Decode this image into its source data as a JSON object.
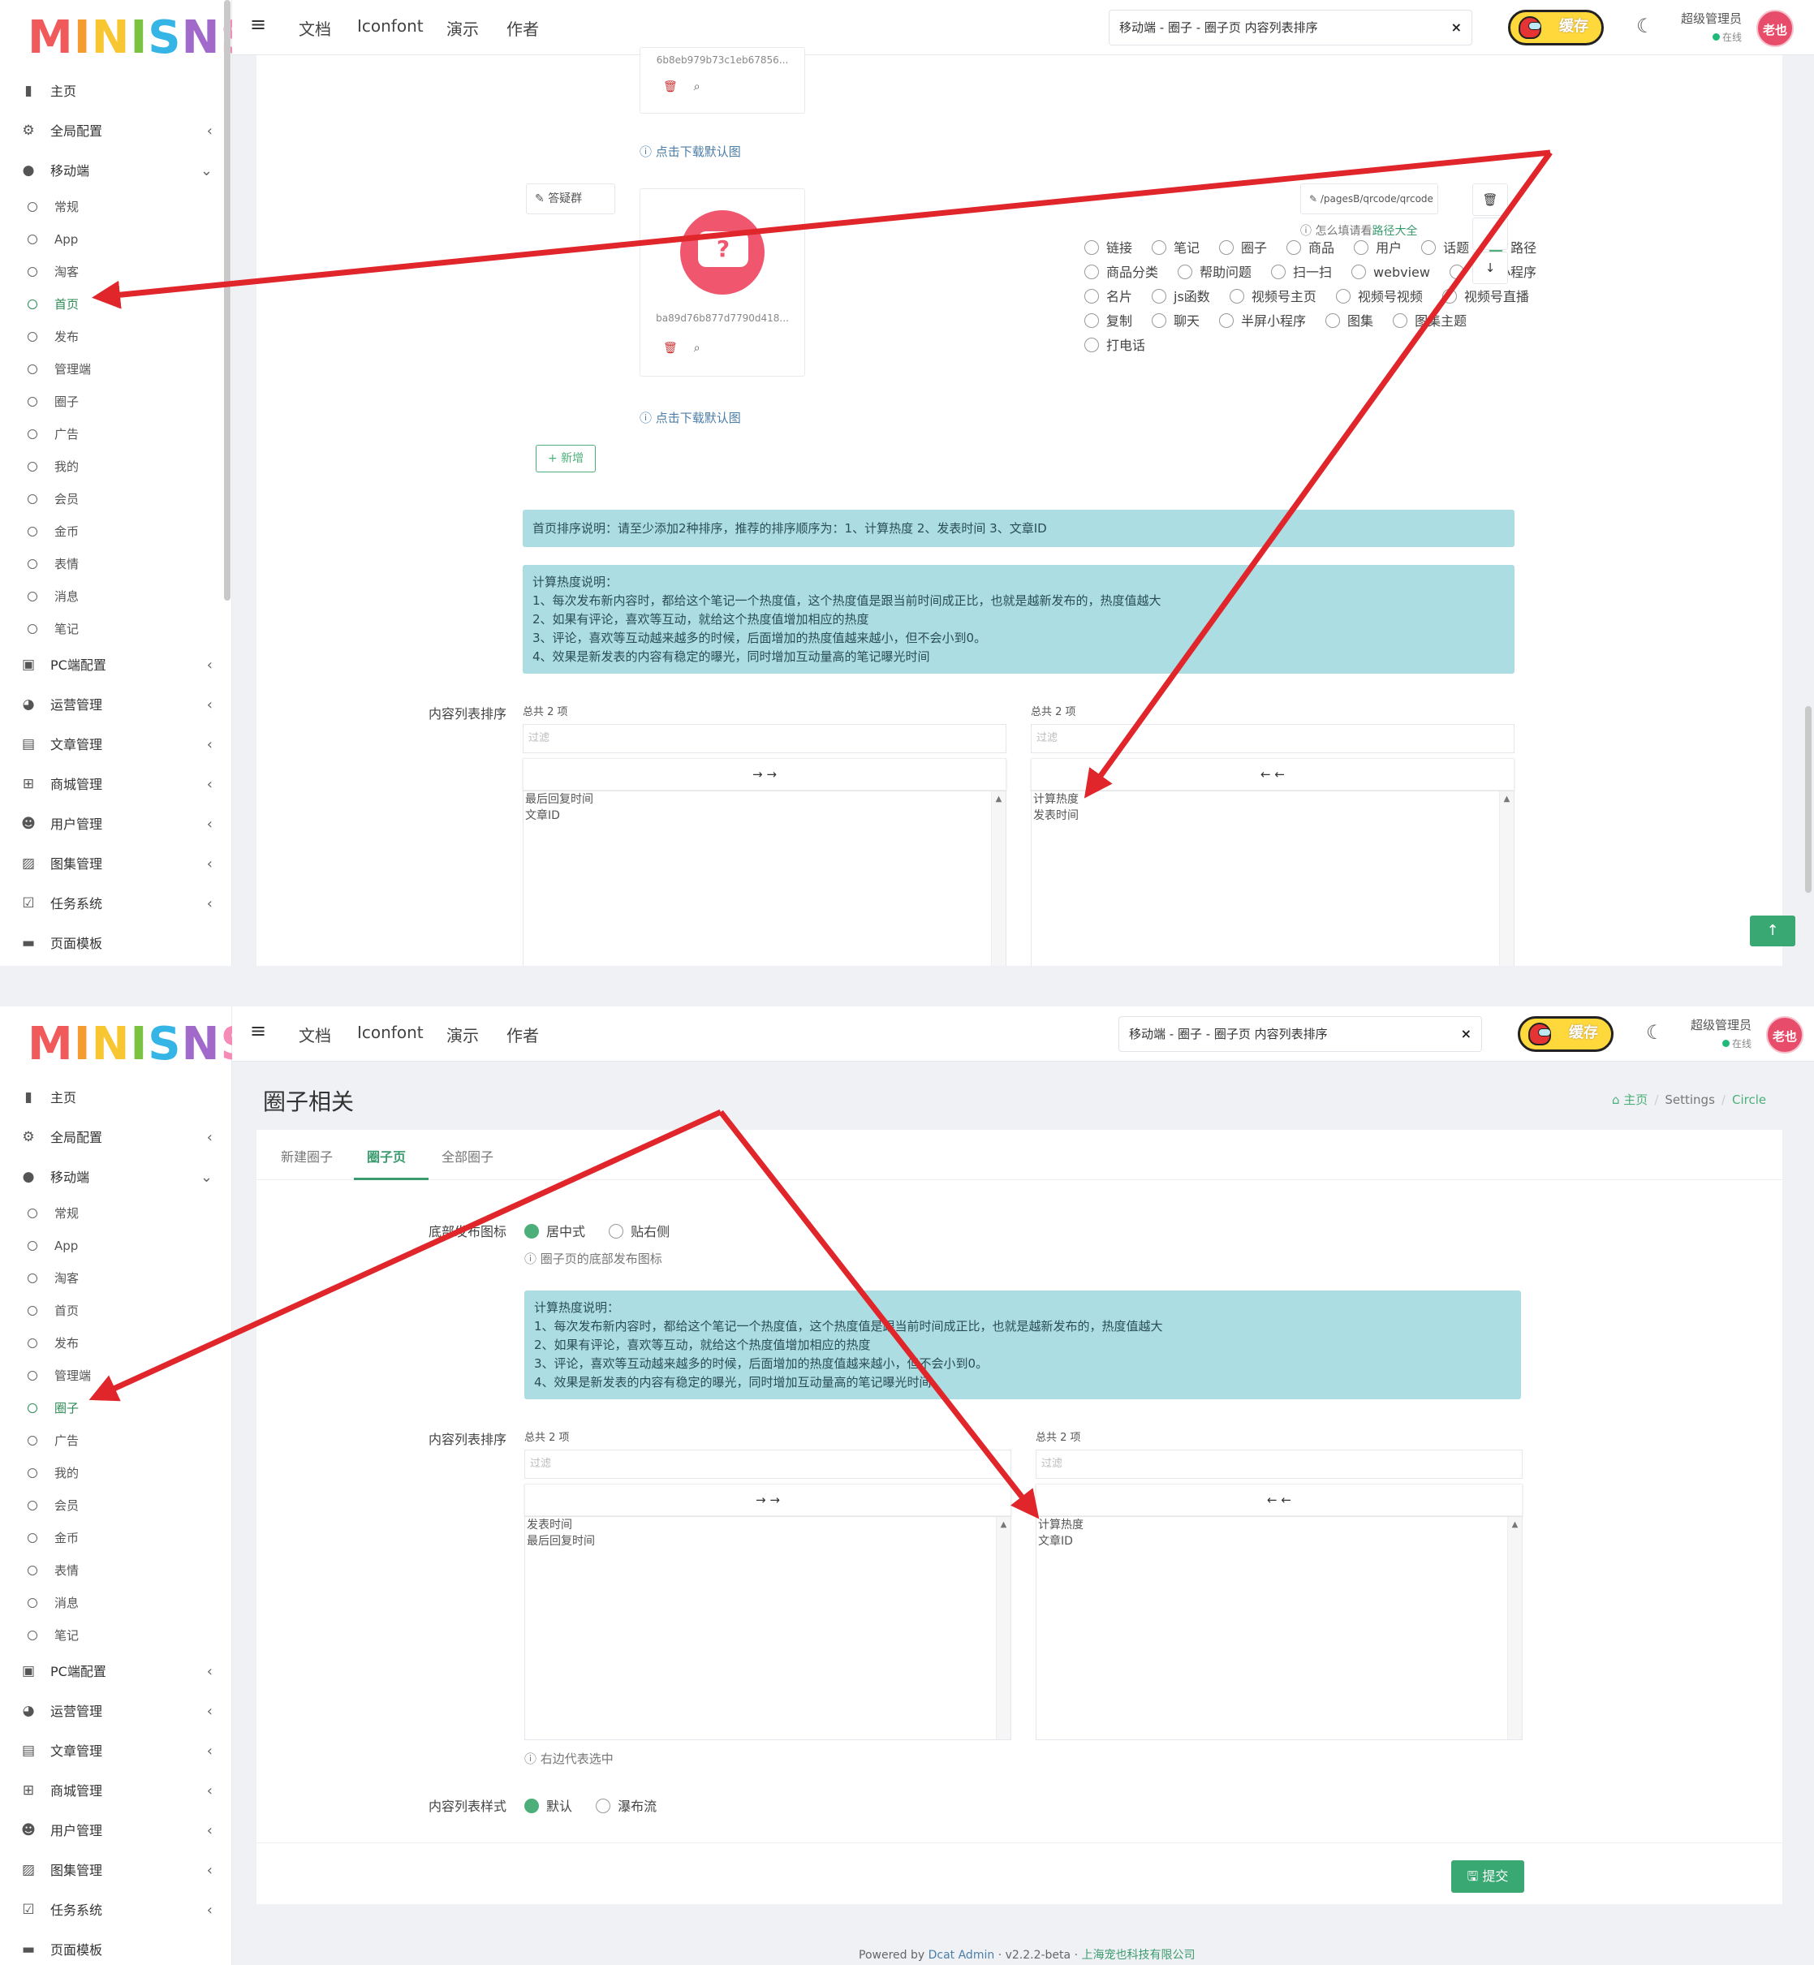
{
  "logo": {
    "text": "MINISNS"
  },
  "topbar": {
    "menu_icon": "hamburger-icon",
    "links": [
      "文档",
      "Iconfont",
      "演示",
      "作者"
    ],
    "tab_title": "移动端 - 圈子 - 圈子页 内容列表排序",
    "tab_close": "×",
    "cache_label": "缓存",
    "user_name": "超级管理员",
    "user_status": "在线",
    "avatar_text": "老也"
  },
  "sidebar": {
    "top_items": [
      {
        "label": "主页",
        "icon": "bar-chart-icon"
      },
      {
        "label": "全局配置",
        "icon": "gear-icon"
      },
      {
        "label": "移动端",
        "icon": "wechat-icon"
      }
    ],
    "sub_items": [
      "常规",
      "App",
      "淘客",
      "首页",
      "发布",
      "管理端",
      "圈子",
      "广告",
      "我的",
      "会员",
      "金币",
      "表情",
      "消息",
      "笔记"
    ],
    "bottom_items": [
      {
        "label": "PC端配置",
        "icon": "camera-icon"
      },
      {
        "label": "运营管理",
        "icon": "pie-chart-icon"
      },
      {
        "label": "文章管理",
        "icon": "book-icon"
      },
      {
        "label": "商城管理",
        "icon": "cart-icon"
      },
      {
        "label": "用户管理",
        "icon": "users-icon"
      },
      {
        "label": "图集管理",
        "icon": "image-icon"
      },
      {
        "label": "任务系统",
        "icon": "checkbox-icon"
      },
      {
        "label": "页面模板",
        "icon": "coffee-icon"
      }
    ]
  },
  "panel1": {
    "active_sub": "首页",
    "hash1": "6b8eb979b73c1eb67856...",
    "download_link": "点击下载默认图",
    "title_input": "答疑群",
    "hash2": "ba89d76b877d7790d418...",
    "radio_rows": [
      [
        "链接",
        "笔记",
        "圈子",
        "商品",
        "用户",
        "话题",
        "路径"
      ],
      [
        "商品分类",
        "帮助问题",
        "扫一扫",
        "webview",
        "三方小程序"
      ],
      [
        "名片",
        "js函数",
        "视频号主页",
        "视频号视频",
        "视频号直播"
      ],
      [
        "复制",
        "聊天",
        "半屏小程序",
        "图集",
        "图集主题"
      ],
      [
        "打电话"
      ]
    ],
    "selected_radio": "路径",
    "path_input": "/pagesB/qrcode/qrcode",
    "path_help": "怎么填请看",
    "path_help_link": "路径大全",
    "add_button": "+ 新增",
    "sort_notice": "首页排序说明：请至少添加2种排序，推荐的排序顺序为：1、计算热度 2、发表时间 3、文章ID",
    "hot_notice": "计算热度说明：\n1、每次发布新内容时，都给这个笔记一个热度值，这个热度值是跟当前时间成正比，也就是越新发布的，热度值越大\n2、如果有评论，喜欢等互动，就给这个热度值增加相应的热度\n3、评论，喜欢等互动越来越多的时候，后面增加的热度值越来越小，但不会小到0。\n4、效果是新发表的内容有稳定的曝光，同时增加互动量高的笔记曝光时间",
    "sort_label": "内容列表排序",
    "left_count": "总共 2 项",
    "right_count": "总共 2 项",
    "filter_placeholder": "过滤",
    "move_right": "→ →",
    "move_left": "← ←",
    "left_items": [
      "最后回复时间",
      "文章ID"
    ],
    "right_items": [
      "计算热度",
      "发表时间"
    ],
    "up_icon": "↑"
  },
  "panel2": {
    "active_sub": "圈子",
    "page_title": "圈子相关",
    "breadcrumb": {
      "home": "主页",
      "settings": "Settings",
      "current": "Circle"
    },
    "tabs": [
      "新建圈子",
      "圈子页",
      "全部圈子"
    ],
    "active_tab": "圈子页",
    "publish_label": "底部发布图标",
    "publish_options": [
      "居中式",
      "贴右侧"
    ],
    "publish_help": "圈子页的底部发布图标",
    "hot_notice": "计算热度说明：\n1、每次发布新内容时，都给这个笔记一个热度值，这个热度值是跟当前时间成正比，也就是越新发布的，热度值越大\n2、如果有评论，喜欢等互动，就给这个热度值增加相应的热度\n3、评论，喜欢等互动越来越多的时候，后面增加的热度值越来越小，但不会小到0。\n4、效果是新发表的内容有稳定的曝光，同时增加互动量高的笔记曝光时间",
    "sort_label": "内容列表排序",
    "left_count": "总共 2 项",
    "right_count": "总共 2 项",
    "filter_placeholder": "过滤",
    "move_right": "→ →",
    "move_left": "← ←",
    "left_items": [
      "发表时间",
      "最后回复时间"
    ],
    "right_items": [
      "计算热度",
      "文章ID"
    ],
    "right_help": "右边代表选中",
    "style_label": "内容列表样式",
    "style_options": [
      "默认",
      "瀑布流"
    ],
    "submit": "提交",
    "footer": {
      "powered": "Powered by",
      "link": "Dcat Admin",
      "version": "· v2.2.2-beta ·",
      "company": "上海宠也科技有限公司"
    }
  },
  "colors": {
    "accent": "#3aa873",
    "notice": "#abdde3",
    "arrow": "#e0252b"
  }
}
